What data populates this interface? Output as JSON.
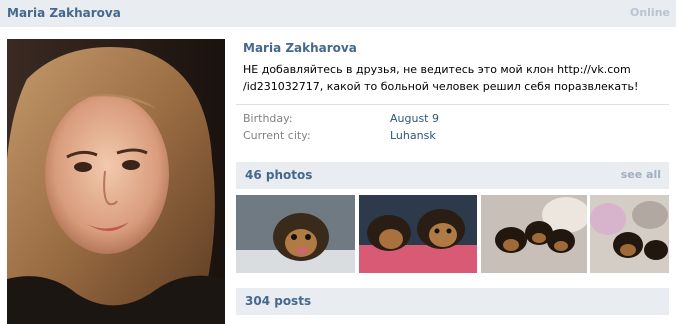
{
  "header": {
    "name": "Maria Zakharova",
    "status": "Online"
  },
  "profile": {
    "name": "Maria Zakharova",
    "status_line1": "НЕ добавляйтесь в друзья, не ведитесь это мой клон http://vk.com",
    "status_line2": "/id231032717, какой то больной человек решил себя поразвлекать!",
    "info": [
      {
        "label": "Birthday:",
        "value": "August 9"
      },
      {
        "label": "Current city:",
        "value": "Luhansk"
      }
    ]
  },
  "photos": {
    "title": "46 photos",
    "see_all": "see all"
  },
  "posts": {
    "title": "304 posts"
  },
  "colors": {
    "accent": "#45688e",
    "bar": "#e9edf1",
    "link": "#2b587a"
  }
}
